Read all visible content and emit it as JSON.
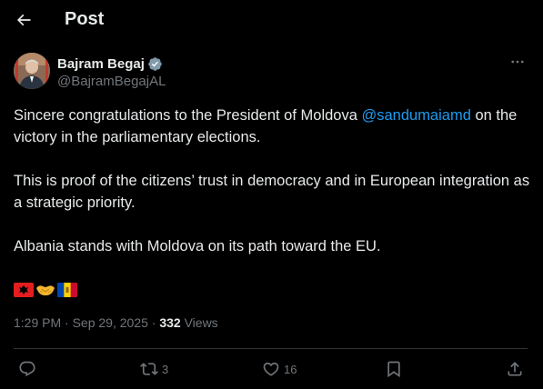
{
  "header": {
    "title": "Post"
  },
  "author": {
    "display_name": "Bajram Begaj",
    "handle": "@BajramBegajAL"
  },
  "tweet": {
    "text_line1_before": "Sincere congratulations to the President of Moldova ",
    "mention": "@sandumaiamd",
    "text_line1_after": " on the victory in the parliamentary elections.",
    "paragraph2": "This is proof of the citizens’ trust in democracy and in European integration as a strategic priority.",
    "paragraph3": "Albania stands with Moldova on its path toward the EU.",
    "emojis": [
      "flag-albania",
      "handshake",
      "flag-moldova"
    ]
  },
  "meta": {
    "time": "1:29 PM",
    "separator": " · ",
    "date": "Sep 29, 2025",
    "views_count": "332",
    "views_label": " Views"
  },
  "actions": {
    "reply_count": "",
    "repost_count": "3",
    "like_count": "16",
    "bookmark_count": ""
  },
  "colors": {
    "background": "#000000",
    "text": "#e7e9ea",
    "muted": "#71767b",
    "accent": "#1d9bf0",
    "divider": "#2f3336"
  },
  "icons": {
    "back": "back-arrow-icon",
    "verified": "verified-badge-icon",
    "more": "more-dots-icon",
    "reply": "reply-icon",
    "repost": "repost-icon",
    "like": "heart-icon",
    "bookmark": "bookmark-icon",
    "share": "share-icon"
  }
}
